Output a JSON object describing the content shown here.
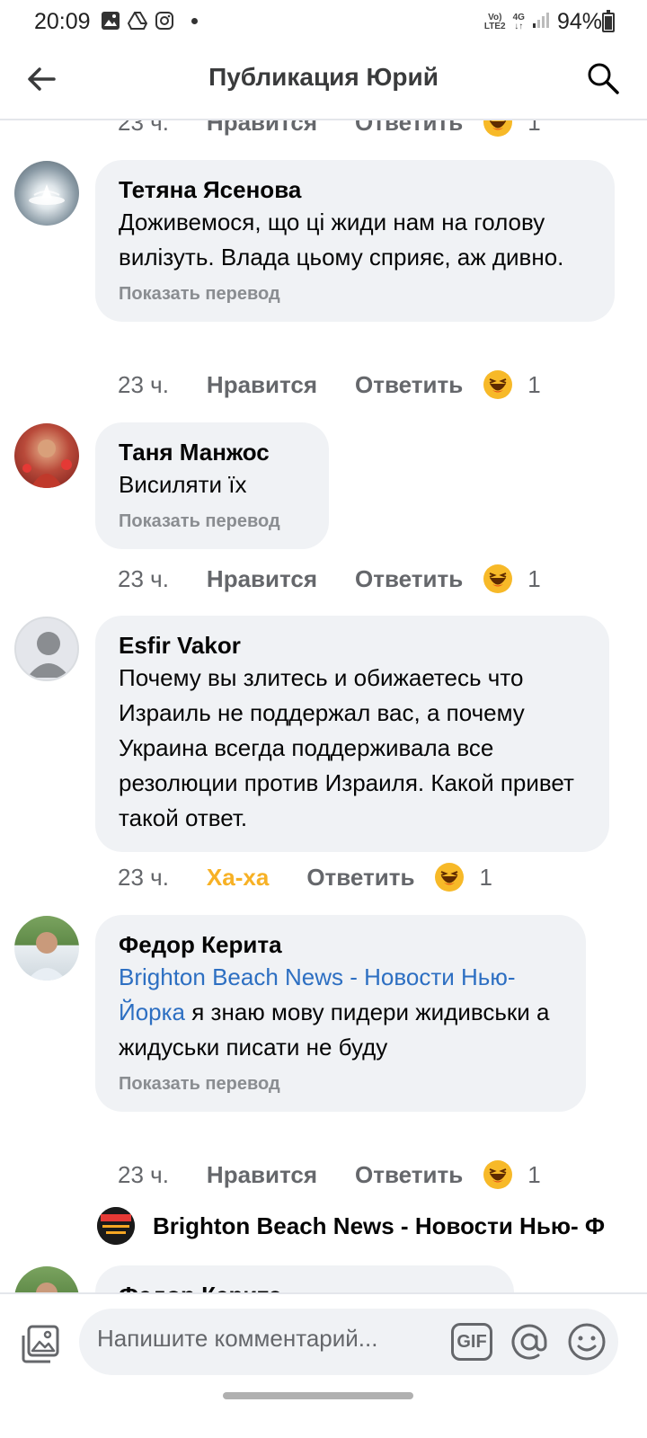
{
  "status_bar": {
    "time": "20:09",
    "network_top": "Vo)",
    "network_bottom": "LTE2",
    "signal_type": "4G",
    "battery": "94%"
  },
  "header": {
    "title": "Публикация Юрий"
  },
  "top_meta": {
    "time": "23 ч.",
    "like": "Нравится",
    "reply": "Ответить",
    "count": "1"
  },
  "comments": [
    {
      "author": "Тетяна Ясенова",
      "text": "Доживемося, що ці жиди нам на голову вилізуть. Влада цьому сприяє, аж дивно.",
      "translate": "Показать перевод",
      "time": "23 ч.",
      "like": "Нравится",
      "reply": "Ответить",
      "reaction_count": "1"
    },
    {
      "author": "Таня Манжос",
      "text": "Висиляти їх",
      "translate": "Показать перевод",
      "time": "23 ч.",
      "like": "Нравится",
      "reply": "Ответить",
      "reaction_count": "1"
    },
    {
      "author": "Esfir Vakor",
      "text": "Почему вы злитесь и обижаетесь что Израиль не поддержал вас, а почему Украина всегда поддерживала все резолюции против Израиля. Какой привет такой ответ.",
      "time": "23 ч.",
      "like": "Ха-ха",
      "reply": "Ответить",
      "reaction_count": "1"
    },
    {
      "author": "Федор Керита",
      "mention": "Brighton Beach News - Новости Нью-Йорка",
      "text": " я знаю мову пидери жидивськи а жидуськи писати не буду",
      "translate": "Показать перевод",
      "time": "23 ч.",
      "like": "Нравится",
      "reply": "Ответить",
      "reaction_count": "1"
    }
  ],
  "reply_preview": {
    "text": "Brighton Beach News - Новости Нью-  Ф"
  },
  "partial_comment": {
    "author": "Федор Керита"
  },
  "composer": {
    "placeholder": "Напишите комментарий...",
    "gif_label": "GIF"
  },
  "colors": {
    "bubble": "#f0f2f5",
    "link": "#2d6fc2",
    "haha": "#f7b125",
    "secondary": "#65676b"
  }
}
